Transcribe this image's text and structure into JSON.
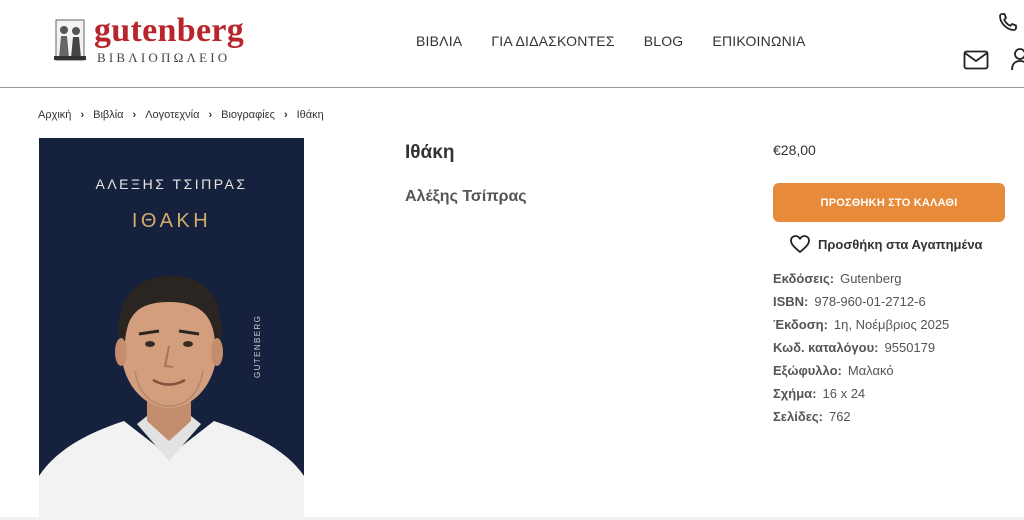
{
  "header": {
    "logo": {
      "word": "gutenberg",
      "sub": "ΒΙΒΛΙΟΠΩΛΕΙΟ"
    },
    "nav": [
      "ΒΙΒΛΙΑ",
      "ΓΙΑ ΔΙΔΑΣΚΟΝΤΕΣ",
      "BLOG",
      "ΕΠΙΚΟΙΝΩΝΙΑ"
    ],
    "icons": [
      "phone-icon",
      "mail-icon",
      "user-icon"
    ]
  },
  "breadcrumb": [
    "Αρχική",
    "Βιβλία",
    "Λογοτεχνία",
    "Βιογραφίες",
    "Ιθάκη"
  ],
  "cover": {
    "author": "ΑΛΕΞΗΣ ΤΣΙΠΡΑΣ",
    "title": "ΙΘΑΚΗ",
    "publisher": "GUTENBERG"
  },
  "product": {
    "title": "Ιθάκη",
    "author": "Αλέξης Τσίπρας",
    "price": "€28,00",
    "add_to_cart": "ΠΡΟΣΘΗΚΗ ΣΤΟ ΚΑΛΑΘΙ",
    "wishlist": "Προσθήκη στα Αγαπημένα"
  },
  "details": [
    {
      "label": "Εκδόσεις:",
      "value": "Gutenberg"
    },
    {
      "label": "ISBN:",
      "value": "978-960-01-2712-6"
    },
    {
      "label": "Έκδοση:",
      "value": "1η, Νοέμβριος 2025"
    },
    {
      "label": "Κωδ. καταλόγου:",
      "value": "9550179"
    },
    {
      "label": "Εξώφυλλο:",
      "value": "Μαλακό"
    },
    {
      "label": "Σχήμα:",
      "value": "16 x 24"
    },
    {
      "label": "Σελίδες:",
      "value": "762"
    }
  ],
  "colors": {
    "brand_red": "#b8262c",
    "cta_orange": "#e78b3b",
    "cover_navy": "#16213d",
    "cover_gold": "#d2ab6a"
  }
}
